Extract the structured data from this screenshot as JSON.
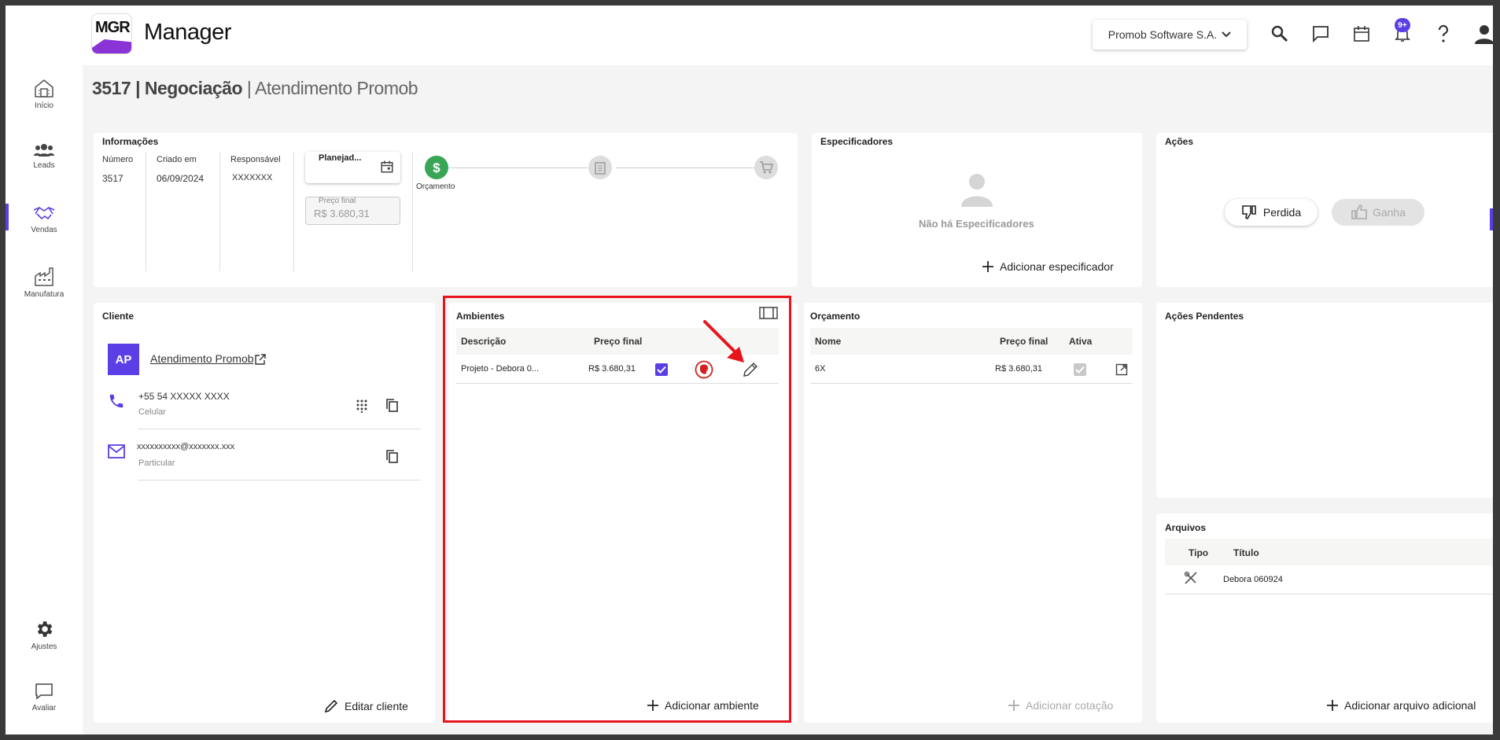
{
  "app": {
    "logo_text": "MGR",
    "title": "Manager"
  },
  "header": {
    "company": "Promob Software S.A.",
    "notifications_badge": "9+"
  },
  "sidebar": {
    "items": [
      {
        "label": "Início",
        "icon": "home-icon"
      },
      {
        "label": "Leads",
        "icon": "people-icon"
      },
      {
        "label": "Vendas",
        "icon": "handshake-icon",
        "active": true
      },
      {
        "label": "Manufatura",
        "icon": "factory-icon"
      },
      {
        "label": "Ajustes",
        "icon": "gear-icon"
      },
      {
        "label": "Avaliar",
        "icon": "chat-icon"
      }
    ]
  },
  "page": {
    "number": "3517",
    "type": "Negociação",
    "name": "Atendimento Promob",
    "sep": "|"
  },
  "info": {
    "title": "Informações",
    "numero_label": "Número",
    "numero_value": "3517",
    "criado_label": "Criado em",
    "criado_value": "06/09/2024",
    "responsavel_label": "Responsável",
    "responsavel_value": "XXXXXXX",
    "status_value": "Planejad...",
    "preco_label": "Preço final",
    "preco_value": "R$ 3.680,31",
    "steps": [
      {
        "label": "Orçamento",
        "state": "active"
      },
      {
        "label": "",
        "state": "pending"
      },
      {
        "label": "",
        "state": "pending"
      }
    ]
  },
  "especificadores": {
    "title": "Especificadores",
    "empty": "Não há Especificadores",
    "add": "Adicionar especificador"
  },
  "acoes": {
    "title": "Ações",
    "perdida": "Perdida",
    "ganha": "Ganha"
  },
  "cliente": {
    "title": "Cliente",
    "avatar": "AP",
    "name": "Atendimento Promob",
    "phone": "+55 54 XXXXX XXXX",
    "phone_type": "Celular",
    "email": "xxxxxxxxxx@xxxxxxx.xxx",
    "email_type": "Particular",
    "edit": "Editar cliente"
  },
  "ambientes": {
    "title": "Ambientes",
    "columns": [
      "Descrição",
      "Preço final"
    ],
    "rows": [
      {
        "descricao": "Projeto - Debora 0...",
        "preco": "R$ 3.680,31",
        "checked": true
      }
    ],
    "add": "Adicionar ambiente"
  },
  "orcamento": {
    "title": "Orçamento",
    "columns": [
      "Nome",
      "Preço final",
      "Ativa"
    ],
    "rows": [
      {
        "nome": "6X",
        "preco": "R$ 3.680,31",
        "ativa": true
      }
    ],
    "add": "Adicionar cotação"
  },
  "pendentes": {
    "title": "Ações Pendentes"
  },
  "arquivos": {
    "title": "Arquivos",
    "columns": [
      "Tipo",
      "Título"
    ],
    "rows": [
      {
        "tipo_icon": "design-tools-icon",
        "titulo": "Debora 060924"
      }
    ],
    "add": "Adicionar arquivo adicional"
  },
  "colors": {
    "accent": "#5b3ee6",
    "success": "#3aa655",
    "annotation": "#e8141b"
  }
}
